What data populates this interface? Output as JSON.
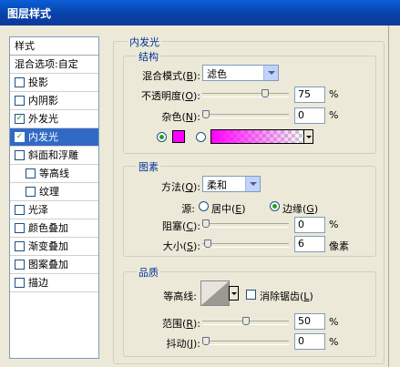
{
  "window": {
    "title": "图层样式"
  },
  "left_panel": {
    "header": "样式",
    "items": [
      {
        "label": "混合选项:自定",
        "checkbox": false,
        "checked": false,
        "selected": false,
        "indent": false
      },
      {
        "label": "投影",
        "checkbox": true,
        "checked": false,
        "selected": false,
        "indent": false
      },
      {
        "label": "内阴影",
        "checkbox": true,
        "checked": false,
        "selected": false,
        "indent": false
      },
      {
        "label": "外发光",
        "checkbox": true,
        "checked": true,
        "selected": false,
        "indent": false
      },
      {
        "label": "内发光",
        "checkbox": true,
        "checked": true,
        "selected": true,
        "indent": false
      },
      {
        "label": "斜面和浮雕",
        "checkbox": true,
        "checked": false,
        "selected": false,
        "indent": false
      },
      {
        "label": "等高线",
        "checkbox": true,
        "checked": false,
        "selected": false,
        "indent": true
      },
      {
        "label": "纹理",
        "checkbox": true,
        "checked": false,
        "selected": false,
        "indent": true
      },
      {
        "label": "光泽",
        "checkbox": true,
        "checked": false,
        "selected": false,
        "indent": false
      },
      {
        "label": "颜色叠加",
        "checkbox": true,
        "checked": false,
        "selected": false,
        "indent": false
      },
      {
        "label": "渐变叠加",
        "checkbox": true,
        "checked": false,
        "selected": false,
        "indent": false
      },
      {
        "label": "图案叠加",
        "checkbox": true,
        "checked": false,
        "selected": false,
        "indent": false
      },
      {
        "label": "描边",
        "checkbox": true,
        "checked": false,
        "selected": false,
        "indent": false
      }
    ]
  },
  "inner_glow": {
    "title": "内发光",
    "structure": {
      "title": "结构",
      "blend_mode": {
        "label": "混合模式(",
        "key": "B",
        "suffix": "):",
        "value": "滤色"
      },
      "opacity": {
        "label": "不透明度(",
        "key": "O",
        "suffix": "):",
        "value": "75",
        "unit": "%",
        "fraction": 0.75
      },
      "noise": {
        "label": "杂色(",
        "key": "N",
        "suffix": "):",
        "value": "0",
        "unit": "%",
        "fraction": 0.0
      },
      "color": "#ff00ff"
    },
    "elements": {
      "title": "图素",
      "technique": {
        "label": "方法(",
        "key": "Q",
        "suffix": "):",
        "value": "柔和"
      },
      "source": {
        "label": "源:",
        "center": {
          "label": "居中(",
          "key": "E",
          "suffix": ")"
        },
        "edge": {
          "label": "边缘(",
          "key": "G",
          "suffix": ")"
        },
        "selected": "edge"
      },
      "choke": {
        "label": "阻塞(",
        "key": "C",
        "suffix": "):",
        "value": "0",
        "unit": "%",
        "fraction": 0.0
      },
      "size": {
        "label": "大小(",
        "key": "S",
        "suffix": "):",
        "value": "6",
        "unit": "像素",
        "fraction": 0.02
      }
    },
    "quality": {
      "title": "品质",
      "contour": {
        "label": "等高线:",
        "anti_alias": {
          "label": "消除锯齿(",
          "key": "L",
          "suffix": ")",
          "checked": false
        }
      },
      "range": {
        "label": "范围(",
        "key": "R",
        "suffix": "):",
        "value": "50",
        "unit": "%",
        "fraction": 0.5
      },
      "jitter": {
        "label": "抖动(",
        "key": "J",
        "suffix": "):",
        "value": "0",
        "unit": "%",
        "fraction": 0.0
      }
    }
  }
}
